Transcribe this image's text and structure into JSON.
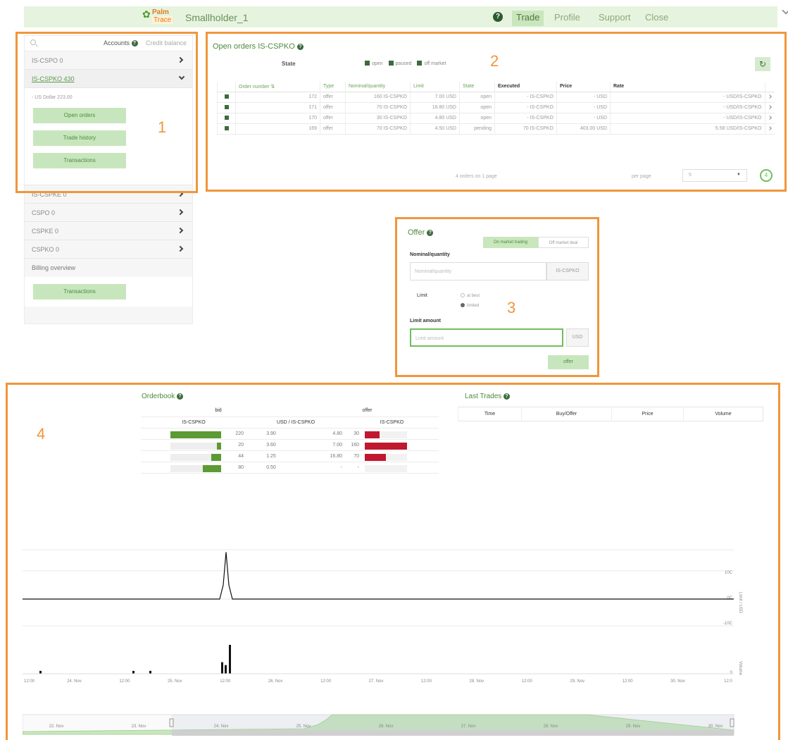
{
  "topbar": {
    "logo": {
      "line1": "Palm",
      "line2": "Trace"
    },
    "user": "Smallholder_1",
    "help": "?",
    "nav": [
      {
        "label": "Trade",
        "active": true
      },
      {
        "label": "Profile",
        "active": false
      },
      {
        "label": "Support",
        "active": false
      },
      {
        "label": "Close",
        "active": false
      }
    ]
  },
  "annotations": [
    "1",
    "2",
    "3",
    "4"
  ],
  "sidebar": {
    "accounts_label": "Accounts",
    "credit_label": "Credit balance",
    "items": [
      {
        "label": "IS-CSPO 0"
      },
      {
        "label": "IS-CSPKO 430"
      }
    ],
    "balance_text": "- US Dollar 223.00",
    "buttons": [
      "Open orders",
      "Trade history",
      "Transactions"
    ],
    "more_items": [
      {
        "label": "IS-CSPKE 0"
      },
      {
        "label": "CSPO 0"
      },
      {
        "label": "CSPKE 0"
      },
      {
        "label": "CSPKO 0"
      }
    ],
    "billing_label": "Billing overview",
    "billing_button": "Transactions"
  },
  "orders": {
    "title": "Open orders IS-CSPKO",
    "state_label": "State",
    "state_options": [
      "open",
      "paused",
      "off market"
    ],
    "refresh_icon": "↻",
    "columns": [
      "Order number ⇅",
      "Type",
      "Nominal/quantity",
      "Limit",
      "State",
      "Executed",
      "Price",
      "Rate"
    ],
    "rows": [
      {
        "num": "172",
        "type": "offer",
        "qty": "160 IS-CSPKO",
        "limit": "7.00 USD",
        "state": "open",
        "exec": "- IS-CSPKO",
        "price": "- USD",
        "rate": "- USD/IS-CSPKO"
      },
      {
        "num": "171",
        "type": "offer",
        "qty": "70 IS-CSPKO",
        "limit": "16.80 USD",
        "state": "open",
        "exec": "- IS-CSPKO",
        "price": "- USD",
        "rate": "- USD/IS-CSPKO"
      },
      {
        "num": "170",
        "type": "offer",
        "qty": "30 IS-CSPKO",
        "limit": "4.80 USD",
        "state": "open",
        "exec": "- IS-CSPKO",
        "price": "- USD",
        "rate": "- USD/IS-CSPKO"
      },
      {
        "num": "169",
        "type": "offer",
        "qty": "70 IS-CSPKO",
        "limit": "4.50 USD",
        "state": "pending",
        "exec": "70 IS-CSPKO",
        "price": "403.00 USD",
        "rate": "5.58 USD/IS-CSPKO"
      }
    ],
    "footer": "4 orders on 1 page",
    "per_page_label": "per page",
    "per_page_value": "5",
    "count": "4"
  },
  "offer": {
    "title": "Offer",
    "seg_on": "On market trading",
    "seg_off": "Off market deal",
    "nominal_label": "Nominal/quantity",
    "nominal_placeholder": "Nominal/quantity",
    "nominal_unit": "IS-CSPKO",
    "limit_label": "Limit",
    "limit_options": [
      {
        "label": "at best",
        "selected": false
      },
      {
        "label": "limited",
        "selected": true
      }
    ],
    "limit_amount_label": "Limit amount",
    "limit_amount_placeholder": "Limit amount",
    "limit_unit": "USD",
    "submit": "offer"
  },
  "orderbook": {
    "title": "Orderbook",
    "bid_label": "bid",
    "offer_label": "offer",
    "col_bid": "IS-CSPKO",
    "col_rate": "USD / IS-CSPKO",
    "col_ask": "IS-CSPKO",
    "rows": [
      {
        "bid_qty": "220",
        "bid_price": "3.90",
        "ask_price": "4.80",
        "ask_qty": "30",
        "bid_frac": 1.0,
        "ask_frac": 0.35
      },
      {
        "bid_qty": "20",
        "bid_price": "3.60",
        "ask_price": "7.00",
        "ask_qty": "160",
        "bid_frac": 0.09,
        "ask_frac": 1.0
      },
      {
        "bid_qty": "44",
        "bid_price": "1.25",
        "ask_price": "16.80",
        "ask_qty": "70",
        "bid_frac": 0.2,
        "ask_frac": 0.5
      },
      {
        "bid_qty": "80",
        "bid_price": "0.50",
        "ask_price": "-",
        "ask_qty": "-",
        "bid_frac": 0.36,
        "ask_frac": 0
      }
    ]
  },
  "last_trades": {
    "title": "Last Trades",
    "columns": [
      "Time",
      "Buy/Offer",
      "Price",
      "Volume"
    ]
  },
  "chart_data": {
    "type": "line",
    "x_labels": [
      "12:00",
      "24. Nov",
      "12:00",
      "25. Nov",
      "12:00",
      "26. Nov",
      "12:00",
      "27. Nov",
      "12:00",
      "28. Nov",
      "12:00",
      "29. Nov",
      "12:00",
      "30. Nov",
      "12:0"
    ],
    "y_labels_price": [
      "10C",
      "0C",
      "-10C"
    ],
    "y_axis_price": "Limit / USD",
    "y_axis_volume": "Volume",
    "y_labels_volume": [
      "0"
    ],
    "price_series": {
      "baseline": 0,
      "spike_peak": 18
    },
    "volume_bars": [
      2,
      2,
      2,
      8,
      6,
      20
    ],
    "navigator_labels": [
      "22. Nov",
      "23. Nov",
      "24. Nov",
      "25. Nov",
      "26. Nov",
      "27. Nov",
      "28. Nov",
      "29. Nov",
      "30. Nov"
    ]
  },
  "colors": {
    "accent": "#4d8a3e",
    "annotation": "#f0963a",
    "bid": "#5c9a33",
    "ask": "#c0182e"
  }
}
